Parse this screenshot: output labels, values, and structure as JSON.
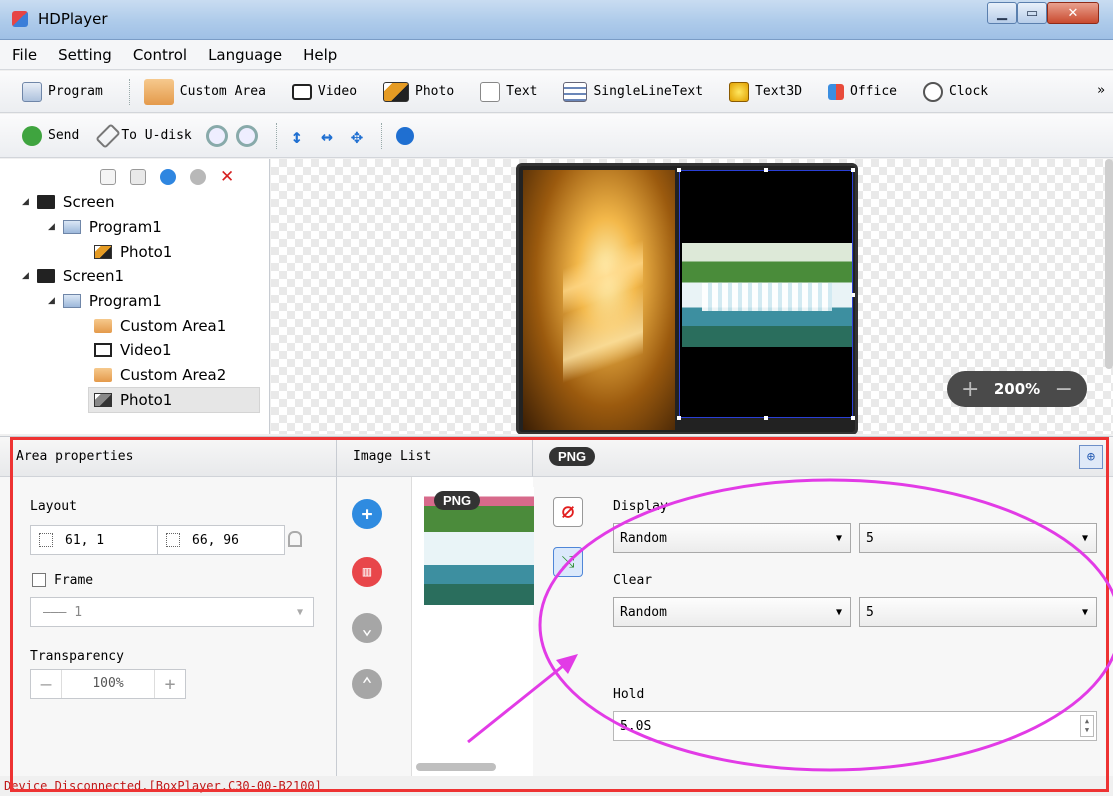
{
  "window": {
    "title": "HDPlayer"
  },
  "menu": [
    "File",
    "Setting",
    "Control",
    "Language",
    "Help"
  ],
  "toolbar1": {
    "items": [
      {
        "label": "Program",
        "icon": "program-icon"
      },
      {
        "label": "Custom Area",
        "icon": "custom-area-icon"
      },
      {
        "label": "Video",
        "icon": "video-icon"
      },
      {
        "label": "Photo",
        "icon": "photo-icon"
      },
      {
        "label": "Text",
        "icon": "text-icon"
      },
      {
        "label": "SingleLineText",
        "icon": "single-line-text-icon"
      },
      {
        "label": "Text3D",
        "icon": "text3d-icon"
      },
      {
        "label": "Office",
        "icon": "office-icon"
      },
      {
        "label": "Clock",
        "icon": "clock-icon"
      }
    ],
    "more": "»"
  },
  "toolbar2": {
    "send": "Send",
    "to_udisk": "To U-disk"
  },
  "tree": {
    "nodes": [
      "Screen",
      "Program1",
      "Photo1",
      "Screen1",
      "Program1",
      "Custom Area1",
      "Video1",
      "Custom Area2",
      "Photo1"
    ],
    "toggle": "◢"
  },
  "canvas": {
    "zoom": "200%",
    "zoom_minus": "−",
    "zoom_plus": "+"
  },
  "area_properties": {
    "title": "Area properties",
    "layout_label": "Layout",
    "position": "61, 1",
    "size": "66, 96",
    "frame_label": "Frame",
    "frame_value": "——— 1",
    "transparency_label": "Transparency",
    "transparency_value": "100%",
    "minus": "—",
    "plus": "+"
  },
  "image_list": {
    "title": "Image List",
    "badge": "PNG"
  },
  "png_panel": {
    "badge": "PNG",
    "display_label": "Display",
    "display_effect": "Random",
    "display_speed": "5",
    "clear_label": "Clear",
    "clear_effect": "Random",
    "clear_speed": "5",
    "hold_label": "Hold",
    "hold_value": "5.0S"
  },
  "status": "Device Disconnected.[BoxPlayer.C30-00-B2100]",
  "colors": {
    "accent_red": "#e33333",
    "annotation_magenta": "#e23be6",
    "selection_blue": "#2a3fd6"
  }
}
